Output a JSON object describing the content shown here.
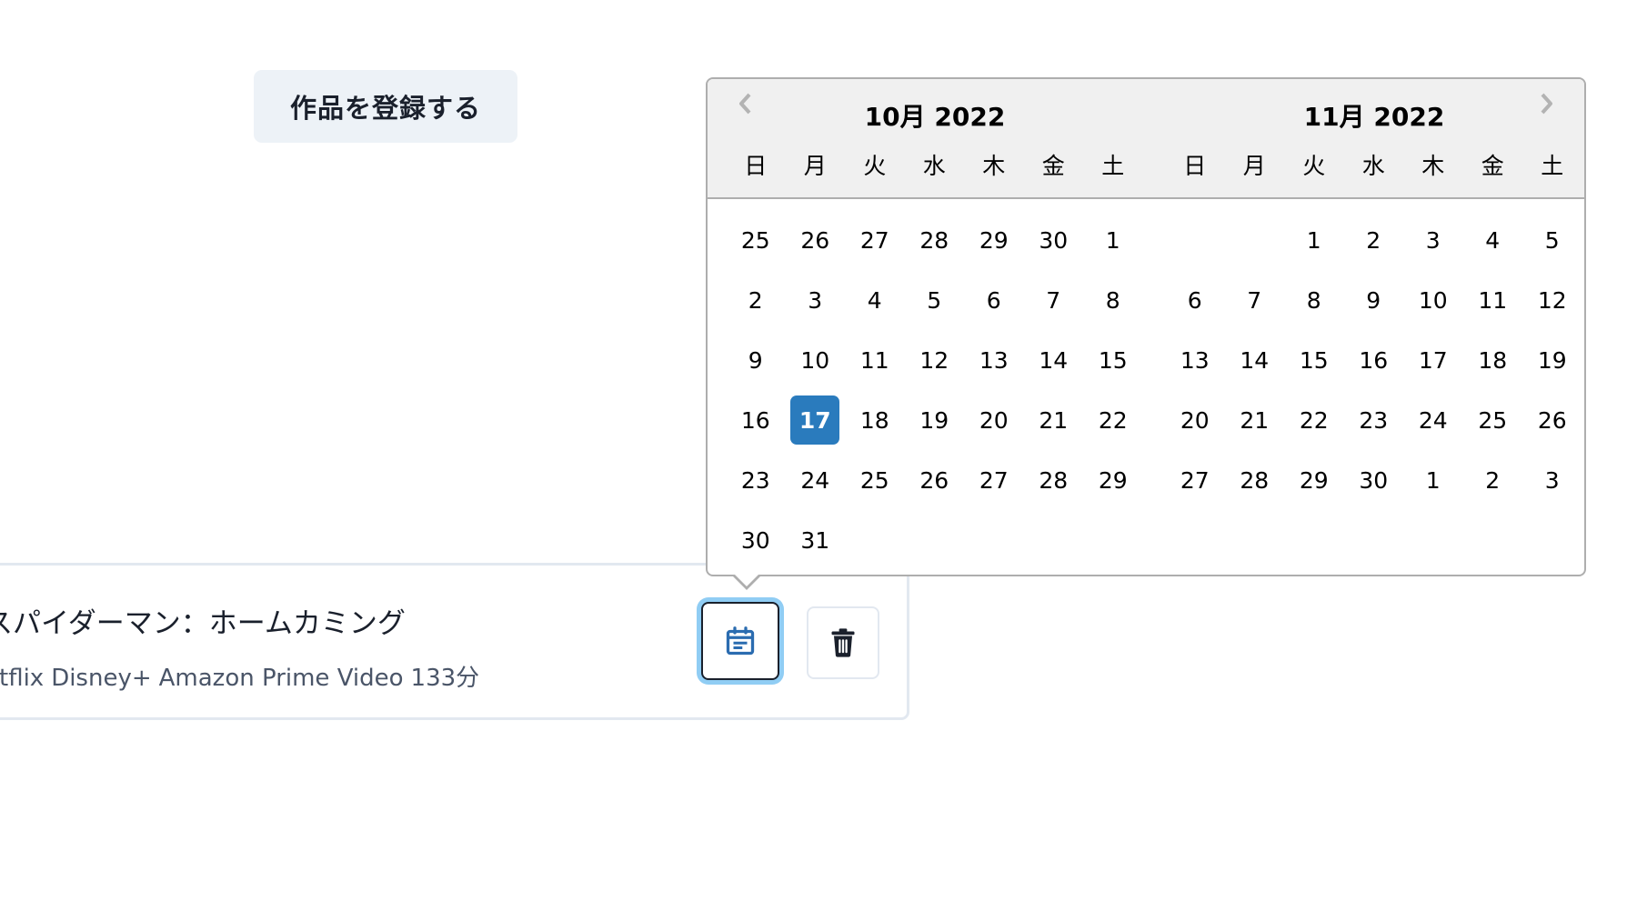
{
  "register_button": {
    "label": "作品を登録する"
  },
  "work_card": {
    "title": "スパイダーマン：ホームカミング",
    "services": [
      "etflix",
      "Disney+",
      "Amazon Prime Video"
    ],
    "runtime": "133分"
  },
  "datepicker": {
    "weekdays": [
      "日",
      "月",
      "火",
      "水",
      "木",
      "金",
      "土"
    ],
    "selected_date": "2022-10-17",
    "months": [
      {
        "title": "10月 2022",
        "weeks": [
          [
            "25",
            "26",
            "27",
            "28",
            "29",
            "30",
            "1"
          ],
          [
            "2",
            "3",
            "4",
            "5",
            "6",
            "7",
            "8"
          ],
          [
            "9",
            "10",
            "11",
            "12",
            "13",
            "14",
            "15"
          ],
          [
            "16",
            "17",
            "18",
            "19",
            "20",
            "21",
            "22"
          ],
          [
            "23",
            "24",
            "25",
            "26",
            "27",
            "28",
            "29"
          ],
          [
            "30",
            "31",
            "",
            "",
            "",
            "",
            ""
          ]
        ]
      },
      {
        "title": "11月 2022",
        "weeks": [
          [
            "",
            "",
            "1",
            "2",
            "3",
            "4",
            "5"
          ],
          [
            "6",
            "7",
            "8",
            "9",
            "10",
            "11",
            "12"
          ],
          [
            "13",
            "14",
            "15",
            "16",
            "17",
            "18",
            "19"
          ],
          [
            "20",
            "21",
            "22",
            "23",
            "24",
            "25",
            "26"
          ],
          [
            "27",
            "28",
            "29",
            "30",
            "1",
            "2",
            "3"
          ]
        ]
      }
    ]
  },
  "colors": {
    "selected_day": "#2a7bbd",
    "focus_ring": "#90cdf4",
    "button_bg": "#edf2f7",
    "header_bg": "#f0f0f0"
  },
  "icons": {
    "calendar_button": "calendar-note-icon",
    "delete_button": "trash-icon",
    "prev_month": "chevron-left-icon",
    "next_month": "chevron-right-icon"
  }
}
